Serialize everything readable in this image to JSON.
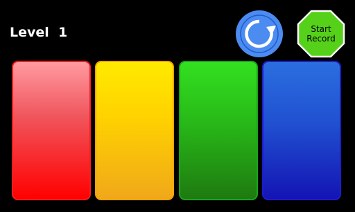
{
  "hud": {
    "level_text": "Level  1"
  },
  "controls": {
    "restart_icon": "refresh-icon",
    "record_label": "Start\nRecord",
    "record_color": "#55d11a"
  },
  "pads": [
    {
      "color": "red",
      "hex": "#ff0000"
    },
    {
      "color": "yellow",
      "hex": "#ffd200"
    },
    {
      "color": "green",
      "hex": "#28b818"
    },
    {
      "color": "blue",
      "hex": "#1414b4"
    }
  ]
}
